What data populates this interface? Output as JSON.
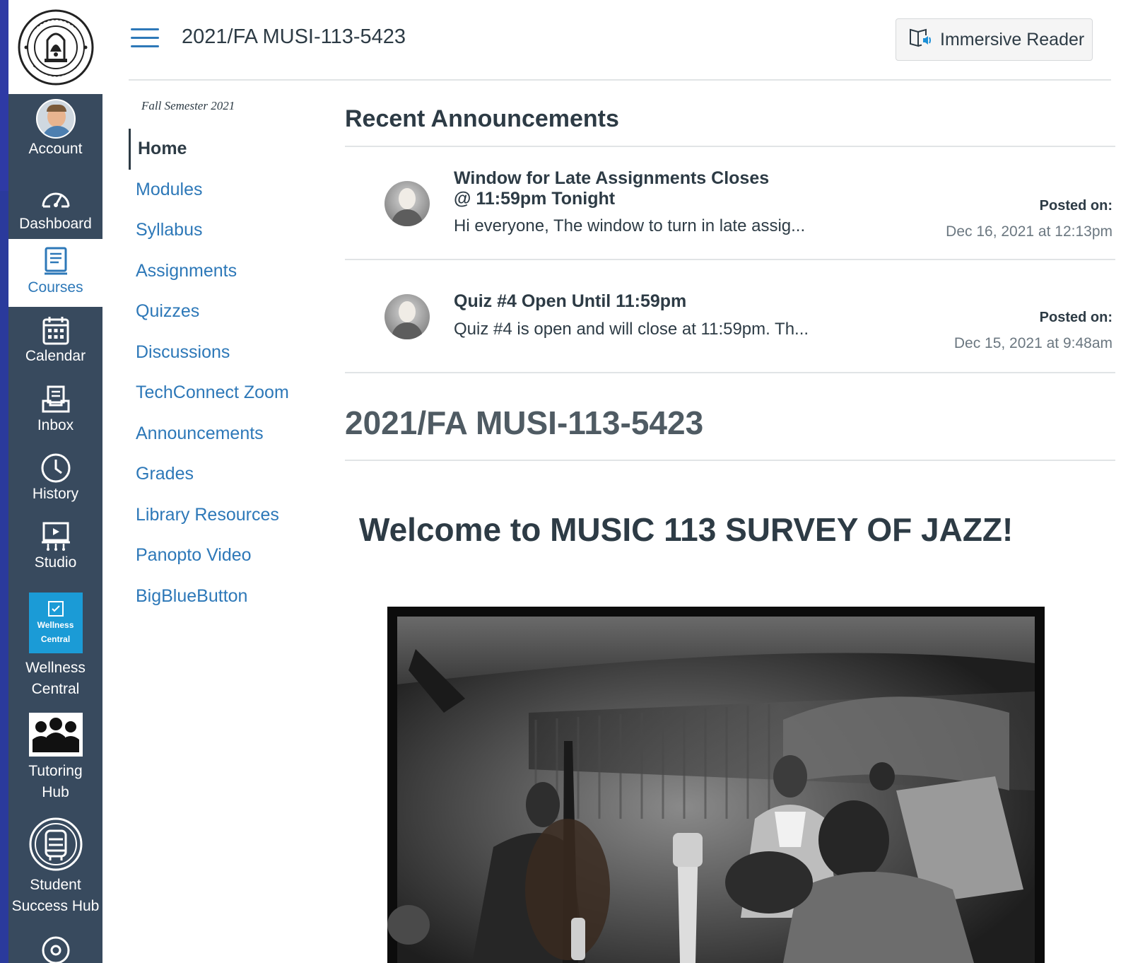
{
  "global_nav": {
    "logo_alt": "El Camino College",
    "items": [
      {
        "label": "Account",
        "icon": "avatar"
      },
      {
        "label": "Dashboard",
        "icon": "dashboard-icon"
      },
      {
        "label": "Courses",
        "icon": "courses-icon",
        "active": true
      },
      {
        "label": "Calendar",
        "icon": "calendar-icon"
      },
      {
        "label": "Inbox",
        "icon": "inbox-icon"
      },
      {
        "label": "History",
        "icon": "clock-icon"
      },
      {
        "label": "Studio",
        "icon": "studio-icon"
      },
      {
        "label": "Wellness Central",
        "icon": "wellness-central-icon",
        "icon_text": "Wellness Central"
      },
      {
        "label": "Tutoring Hub",
        "icon": "tutoring-hub-icon"
      },
      {
        "label": "Student Success Hub",
        "icon": "student-success-hub-icon"
      }
    ]
  },
  "header": {
    "course_title": "2021/FA MUSI-113-5423",
    "immersive_reader_label": "Immersive Reader"
  },
  "course_nav": {
    "term": "Fall Semester 2021",
    "links": [
      {
        "label": "Home",
        "active": true
      },
      {
        "label": "Modules"
      },
      {
        "label": "Syllabus"
      },
      {
        "label": "Assignments"
      },
      {
        "label": "Quizzes"
      },
      {
        "label": "Discussions"
      },
      {
        "label": "TechConnect Zoom"
      },
      {
        "label": "Announcements"
      },
      {
        "label": "Grades"
      },
      {
        "label": "Library Resources"
      },
      {
        "label": "Panopto Video"
      },
      {
        "label": "BigBlueButton"
      }
    ]
  },
  "main": {
    "recent_announcements_heading": "Recent Announcements",
    "announcements": [
      {
        "title": "Window for Late Assignments Closes @ 11:59pm Tonight",
        "snippet": "Hi everyone,  The window to turn in late assig...",
        "posted_label": "Posted on:",
        "posted_date": "Dec 16, 2021 at 12:13pm"
      },
      {
        "title": "Quiz #4 Open Until 11:59pm",
        "snippet": "Quiz #4 is open and will close at 11:59pm. Th...",
        "posted_label": "Posted on:",
        "posted_date": "Dec 15, 2021 at 9:48am"
      }
    ],
    "course_title": "2021/FA MUSI-113-5423",
    "welcome": "Welcome to MUSIC 113 SURVEY OF JAZZ!",
    "photo_alt": "Black and white photo of jazz musicians performing"
  }
}
